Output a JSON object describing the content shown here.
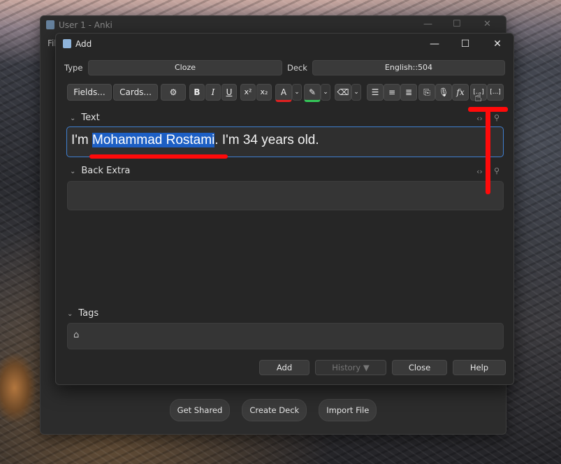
{
  "main_window": {
    "title": "User 1 - Anki",
    "menu_partial": "Fil",
    "bottom_buttons": [
      "Get Shared",
      "Create Deck",
      "Import File"
    ]
  },
  "dialog": {
    "title": "Add",
    "type_label": "Type",
    "type_value": "Cloze",
    "deck_label": "Deck",
    "deck_value": "English::504"
  },
  "toolbar": {
    "fields": "Fields...",
    "cards": "Cards...",
    "bold": "B",
    "italic": "I",
    "underline": "U",
    "superscript": "x²",
    "subscript": "x₂",
    "text_color": "A",
    "cloze": "[...]",
    "cloze_alt": "[...]",
    "formula": "fx"
  },
  "fields": {
    "text_label": "Text",
    "text_before": "I'm ",
    "text_selected": "Mohammad Rostami",
    "text_after": ". I'm 34 years old.",
    "back_extra_label": "Back Extra",
    "tags_label": "Tags"
  },
  "actions": {
    "add": "Add",
    "history": "History ▼",
    "close": "Close",
    "help": "Help"
  },
  "colors": {
    "accent": "#3f7fd0",
    "selection": "#1d5fc4",
    "annotation": "#ff0a0a",
    "text_color_underline": "#e02020",
    "highlight_underline": "#34c759"
  }
}
